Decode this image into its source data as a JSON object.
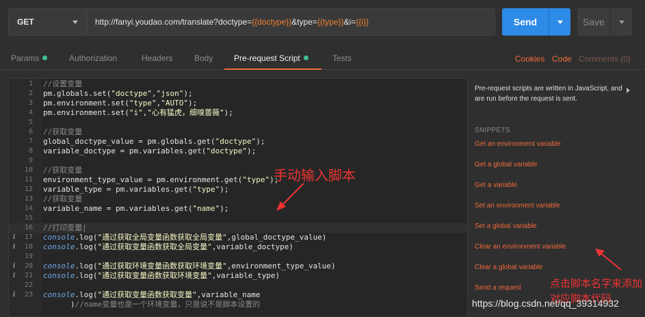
{
  "request": {
    "method": "GET",
    "url_parts": [
      {
        "text": "http://fanyi.youdao.com/translate?doctype=",
        "var": false
      },
      {
        "text": "{{doctype}}",
        "var": true
      },
      {
        "text": "&type=",
        "var": false
      },
      {
        "text": "{{type}}",
        "var": true
      },
      {
        "text": "&i=",
        "var": false
      },
      {
        "text": "{{i}}",
        "var": true
      }
    ],
    "send_label": "Send",
    "save_label": "Save"
  },
  "tabs": {
    "params": "Params",
    "authorization": "Authorization",
    "headers": "Headers",
    "body": "Body",
    "prerequest": "Pre-request Script",
    "tests": "Tests"
  },
  "links": {
    "cookies": "Cookies",
    "code": "Code",
    "comments": "Comments (0)"
  },
  "editor": {
    "lines": [
      {
        "n": "1",
        "tokens": [
          {
            "t": "//设置变量",
            "c": "cm"
          }
        ]
      },
      {
        "n": "2",
        "tokens": [
          {
            "t": "pm.globals.set(",
            "c": ""
          },
          {
            "t": "\"doctype\"",
            "c": "st"
          },
          {
            "t": ",",
            "c": ""
          },
          {
            "t": "\"json\"",
            "c": "st"
          },
          {
            "t": ");",
            "c": ""
          }
        ]
      },
      {
        "n": "3",
        "tokens": [
          {
            "t": "pm.environment.set(",
            "c": ""
          },
          {
            "t": "\"type\"",
            "c": "st"
          },
          {
            "t": ",",
            "c": ""
          },
          {
            "t": "\"AUTO\"",
            "c": "st"
          },
          {
            "t": ");",
            "c": ""
          }
        ]
      },
      {
        "n": "4",
        "tokens": [
          {
            "t": "pm.environment.set(",
            "c": ""
          },
          {
            "t": "\"i\"",
            "c": "st"
          },
          {
            "t": ",",
            "c": ""
          },
          {
            "t": "\"心有猛虎，细嗅蔷薇\"",
            "c": "st"
          },
          {
            "t": ");",
            "c": ""
          }
        ]
      },
      {
        "n": "5",
        "tokens": []
      },
      {
        "n": "6",
        "tokens": [
          {
            "t": "//获取变量",
            "c": "cm"
          }
        ]
      },
      {
        "n": "7",
        "tokens": [
          {
            "t": "global_doctype_value = pm.globals.get(",
            "c": ""
          },
          {
            "t": "\"doctype\"",
            "c": "st"
          },
          {
            "t": ");",
            "c": ""
          }
        ]
      },
      {
        "n": "8",
        "tokens": [
          {
            "t": "variable_doctype = pm.variables.get(",
            "c": ""
          },
          {
            "t": "\"doctype\"",
            "c": "st"
          },
          {
            "t": ");",
            "c": ""
          }
        ]
      },
      {
        "n": "9",
        "tokens": []
      },
      {
        "n": "10",
        "tokens": [
          {
            "t": "//获取变量",
            "c": "cm"
          }
        ]
      },
      {
        "n": "11",
        "tokens": [
          {
            "t": "environment_type_value = pm.environment.get(",
            "c": ""
          },
          {
            "t": "\"type\"",
            "c": "st"
          },
          {
            "t": ");",
            "c": ""
          }
        ]
      },
      {
        "n": "12",
        "tokens": [
          {
            "t": "variable_type = pm.variables.get(",
            "c": ""
          },
          {
            "t": "\"type\"",
            "c": "st"
          },
          {
            "t": ");",
            "c": ""
          }
        ]
      },
      {
        "n": "13",
        "tokens": [
          {
            "t": "//获取变量",
            "c": "cm"
          }
        ]
      },
      {
        "n": "14",
        "tokens": [
          {
            "t": "variable_name = pm.variables.get(",
            "c": ""
          },
          {
            "t": "\"name\"",
            "c": "st"
          },
          {
            "t": ");",
            "c": ""
          }
        ]
      },
      {
        "n": "15",
        "tokens": []
      },
      {
        "n": "16",
        "tokens": [
          {
            "t": "//打印变量|",
            "c": "cm"
          }
        ],
        "current": true
      },
      {
        "n": "17",
        "info": true,
        "tokens": [
          {
            "t": "console",
            "c": "fn"
          },
          {
            "t": ".log(",
            "c": ""
          },
          {
            "t": "\"通过获取全局变量函数获取全局变量\"",
            "c": "st"
          },
          {
            "t": ",global_doctype_value)",
            "c": ""
          }
        ]
      },
      {
        "n": "18",
        "info": true,
        "tokens": [
          {
            "t": "console",
            "c": "fn"
          },
          {
            "t": ".log(",
            "c": ""
          },
          {
            "t": "\"通过获取变量函数获取全局变量\"",
            "c": "st"
          },
          {
            "t": ",variable_doctype)",
            "c": ""
          }
        ]
      },
      {
        "n": "19",
        "tokens": []
      },
      {
        "n": "20",
        "info": true,
        "tokens": [
          {
            "t": "console",
            "c": "fn"
          },
          {
            "t": ".log(",
            "c": ""
          },
          {
            "t": "\"通过获取环境变量函数获取环境变量\"",
            "c": "st"
          },
          {
            "t": ",environment_type_value)",
            "c": ""
          }
        ]
      },
      {
        "n": "21",
        "info": true,
        "tokens": [
          {
            "t": "console",
            "c": "fn"
          },
          {
            "t": ".log(",
            "c": ""
          },
          {
            "t": "\"通过获取变量函数获取环境变量\"",
            "c": "st"
          },
          {
            "t": ",variable_type)",
            "c": ""
          }
        ]
      },
      {
        "n": "22",
        "tokens": []
      },
      {
        "n": "23",
        "info": true,
        "tokens": [
          {
            "t": "console",
            "c": "fn"
          },
          {
            "t": ".log(",
            "c": ""
          },
          {
            "t": "\"通过获取变量函数获取变量\"",
            "c": "st"
          },
          {
            "t": ",variable_name",
            "c": ""
          }
        ]
      }
    ],
    "wrap_tokens": [
      {
        "t": ")",
        "c": ""
      },
      {
        "t": "//name变量也是一个环境变量，只是说不是脚本设置的",
        "c": "cm"
      }
    ],
    "info_glyph": "i"
  },
  "annotations": {
    "left": "手动输入脚本",
    "right": "点击脚本名字来添加对应脚本代码"
  },
  "side": {
    "description": "Pre-request scripts are written in JavaScript, and are run before the request is sent.",
    "snippets_title": "SNIPPETS",
    "snippets": [
      "Get an environment variable",
      "Get a global variable",
      "Get a variable",
      "Set an environment variable",
      "Set a global variable",
      "Clear an environment variable",
      "Clear a global variable",
      "Send a request"
    ]
  },
  "watermark": "https://blog.csdn.net/qq_39314932",
  "colors": {
    "accent": "#f26b3a",
    "send": "#2d8ae6",
    "annotation": "#ee3333",
    "active_dot": "#3fbf8f"
  }
}
